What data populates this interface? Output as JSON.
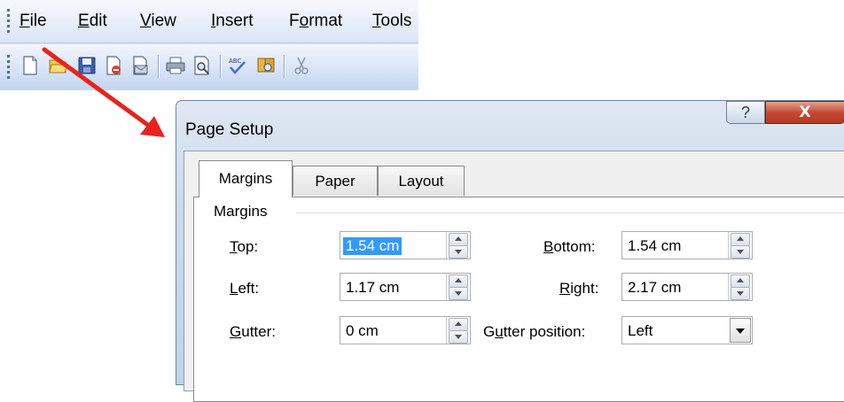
{
  "menubar": {
    "items": [
      {
        "mnemonic": "F",
        "rest": "ile"
      },
      {
        "mnemonic": "E",
        "rest": "dit"
      },
      {
        "mnemonic": "V",
        "rest": "iew"
      },
      {
        "mnemonic": "I",
        "rest": "nsert"
      },
      {
        "pre": "F",
        "mnemonic": "o",
        "rest": "rmat"
      },
      {
        "mnemonic": "T",
        "rest": "ools"
      }
    ]
  },
  "toolbar": {
    "icons": [
      "new-document-icon",
      "open-folder-icon",
      "save-icon",
      "permission-icon",
      "email-icon",
      "print-icon",
      "print-preview-icon",
      "spelling-icon",
      "research-icon",
      "cut-icon"
    ]
  },
  "annotation": {
    "arrow_color": "#e8231c"
  },
  "dialog": {
    "title": "Page Setup",
    "help_label": "?",
    "close_label": "X",
    "tabs": [
      {
        "label": "Margins",
        "active": true
      },
      {
        "label": "Paper",
        "active": false
      },
      {
        "label": "Layout",
        "active": false
      }
    ],
    "margins_group_label": "Margins",
    "fields": {
      "top": {
        "mnemonic": "T",
        "rest": "op:",
        "value": "1.54 cm"
      },
      "left": {
        "mnemonic": "L",
        "rest": "eft:",
        "value": "1.17 cm"
      },
      "gutter": {
        "mnemonic": "G",
        "rest": "utter:",
        "value": "0 cm"
      },
      "bottom": {
        "mnemonic": "B",
        "rest": "ottom:",
        "value": "1.54 cm"
      },
      "right": {
        "mnemonic": "R",
        "rest": "ight:",
        "value": "2.17 cm"
      },
      "gutter_position": {
        "pre": "G",
        "mnemonic": "u",
        "rest": "tter position:",
        "value": "Left"
      }
    }
  }
}
